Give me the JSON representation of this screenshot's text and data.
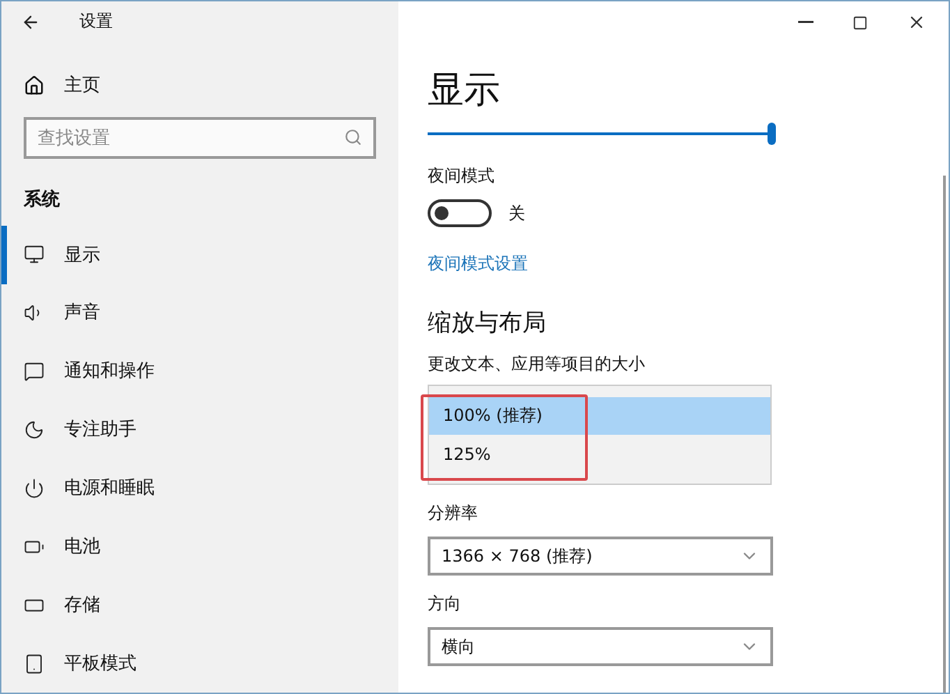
{
  "window": {
    "title": "设置"
  },
  "sidebar": {
    "home": "主页",
    "search": {
      "placeholder": "查找设置"
    },
    "section": "系统",
    "items": [
      {
        "label": "显示",
        "selected": true
      },
      {
        "label": "声音",
        "selected": false
      },
      {
        "label": "通知和操作",
        "selected": false
      },
      {
        "label": "专注助手",
        "selected": false
      },
      {
        "label": "电源和睡眠",
        "selected": false
      },
      {
        "label": "电池",
        "selected": false
      },
      {
        "label": "存储",
        "selected": false
      },
      {
        "label": "平板模式",
        "selected": false
      }
    ]
  },
  "content": {
    "title": "显示",
    "brightness": {
      "level": 1
    },
    "night_light": {
      "label": "夜间模式",
      "on": false,
      "state_text": "关",
      "link": "夜间模式设置"
    },
    "scale_section": "缩放与布局",
    "scale": {
      "label": "更改文本、应用等项目的大小",
      "expanded": true,
      "highlighted": true,
      "options": [
        {
          "label": "100% (推荐)",
          "selected": true
        },
        {
          "label": "125%",
          "selected": false
        }
      ]
    },
    "resolution": {
      "label": "分辨率",
      "value": "1366 × 768 (推荐)"
    },
    "orientation": {
      "label": "方向",
      "value": "横向"
    }
  }
}
